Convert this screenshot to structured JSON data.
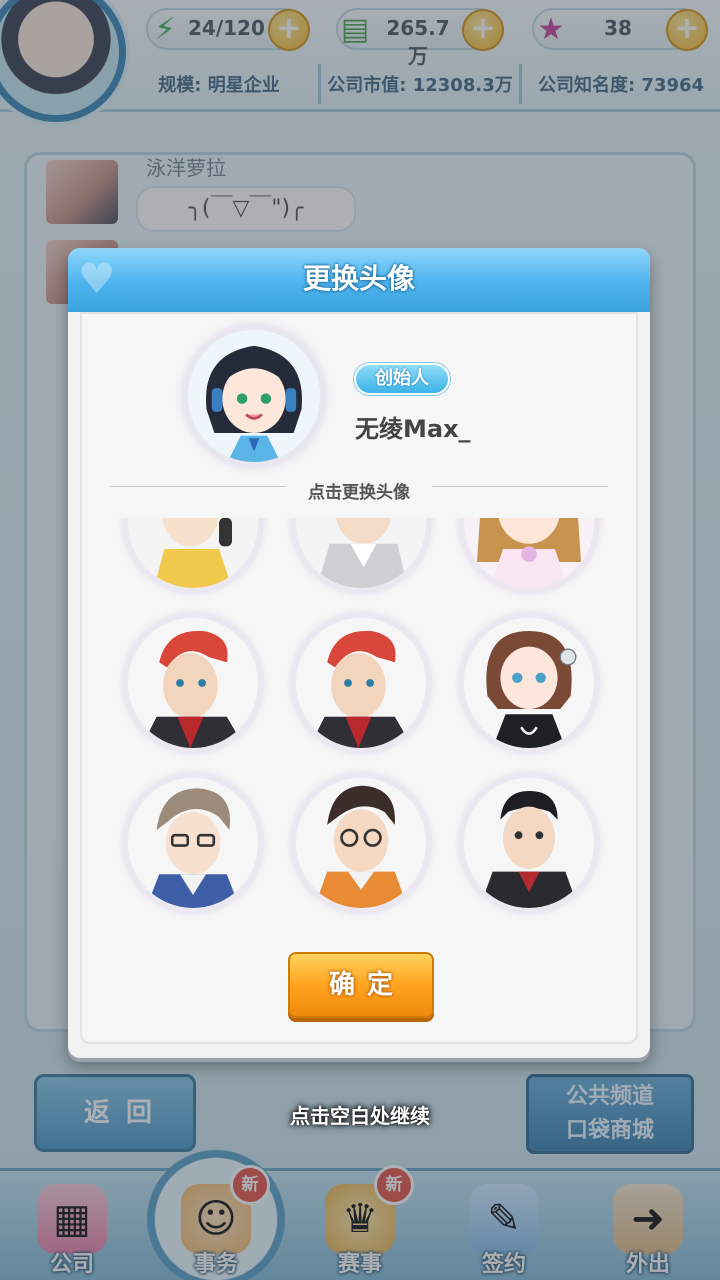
{
  "topbar": {
    "energy": "24/120",
    "money": "265.7万",
    "gems": "38",
    "stats": [
      "规模: 明星企业",
      "公司市值: 12308.3万",
      "公司知名度: 73964"
    ]
  },
  "background": {
    "list_name": "泳洋萝拉",
    "list_message": "╮(￣▽￣\")╭",
    "back_label": "返回",
    "channel_line1": "公共频道",
    "channel_line2": "口袋商城",
    "continue_hint": "点击空白处继续"
  },
  "navbar": {
    "items": [
      {
        "label": "公司",
        "icon": "building-icon",
        "badge": ""
      },
      {
        "label": "事务",
        "icon": "character-icon",
        "badge": "新"
      },
      {
        "label": "赛事",
        "icon": "trophy-icon",
        "badge": "新"
      },
      {
        "label": "签约",
        "icon": "contract-icon",
        "badge": ""
      },
      {
        "label": "外出",
        "icon": "door-icon",
        "badge": ""
      }
    ]
  },
  "modal": {
    "title": "更换头像",
    "role_badge": "创始人",
    "user_name": "无绫Max_",
    "divider_label": "点击更换头像",
    "confirm_label": "确定"
  },
  "colors": {
    "header_blue": "#4eb4ee",
    "confirm_orange": "#ffa31f",
    "badge_blue": "#3bb3e8",
    "new_badge_red": "#e2483a"
  }
}
